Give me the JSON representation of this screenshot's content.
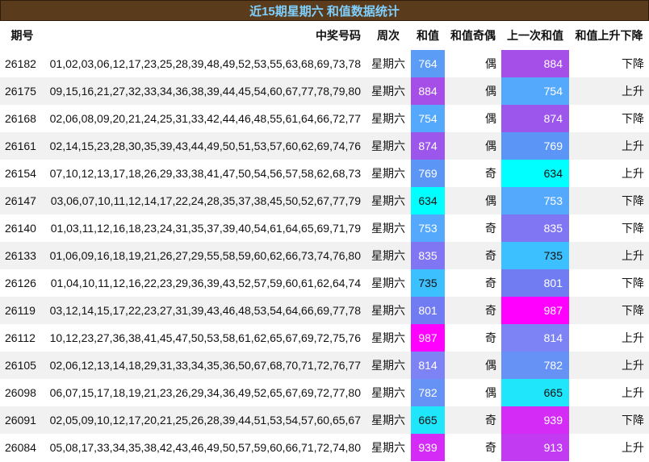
{
  "title": "近15期星期六 和值数据统计",
  "headers": {
    "period": "期号",
    "numbers": "中奖号码",
    "weekday": "周次",
    "sum": "和值",
    "parity": "和值奇偶",
    "prev_sum": "上一次和值",
    "trend": "和值上升下降"
  },
  "rows": [
    {
      "period": "26182",
      "numbers": "01,02,03,06,12,17,23,25,28,39,48,49,52,53,55,63,68,69,73,78",
      "weekday": "星期六",
      "sum": "764",
      "sum_color": "#5a9cf6",
      "parity": "偶",
      "prev_sum": "884",
      "prev_color": "#a64fe8",
      "trend": "下降"
    },
    {
      "period": "26175",
      "numbers": "09,15,16,21,27,32,33,34,36,38,39,44,45,54,60,67,77,78,79,80",
      "weekday": "星期六",
      "sum": "884",
      "sum_color": "#a64fe8",
      "parity": "偶",
      "prev_sum": "754",
      "prev_color": "#55a9fc",
      "trend": "上升"
    },
    {
      "period": "26168",
      "numbers": "02,06,08,09,20,21,24,25,31,33,42,44,46,48,55,61,64,66,72,77",
      "weekday": "星期六",
      "sum": "754",
      "sum_color": "#55a9fc",
      "parity": "偶",
      "prev_sum": "874",
      "prev_color": "#9c56ec",
      "trend": "下降"
    },
    {
      "period": "26161",
      "numbers": "02,14,15,23,28,30,35,39,43,44,49,50,51,53,57,60,62,69,74,76",
      "weekday": "星期六",
      "sum": "874",
      "sum_color": "#9c56ec",
      "parity": "偶",
      "prev_sum": "769",
      "prev_color": "#5b96f6",
      "trend": "上升"
    },
    {
      "period": "26154",
      "numbers": "07,10,12,13,17,18,26,29,33,38,41,47,50,54,56,57,58,62,68,73",
      "weekday": "星期六",
      "sum": "769",
      "sum_color": "#5b96f6",
      "parity": "奇",
      "prev_sum": "634",
      "prev_color": "#00ffff",
      "trend": "上升"
    },
    {
      "period": "26147",
      "numbers": "03,06,07,10,11,12,14,17,22,24,28,35,37,38,45,50,52,67,77,79",
      "weekday": "星期六",
      "sum": "634",
      "sum_color": "#00ffff",
      "parity": "偶",
      "prev_sum": "753",
      "prev_color": "#55a9fc",
      "trend": "下降"
    },
    {
      "period": "26140",
      "numbers": "01,03,11,12,16,18,23,24,31,35,37,39,40,54,61,64,65,69,71,79",
      "weekday": "星期六",
      "sum": "753",
      "sum_color": "#55a9fc",
      "parity": "奇",
      "prev_sum": "835",
      "prev_color": "#8075f2",
      "trend": "下降"
    },
    {
      "period": "26133",
      "numbers": "01,06,09,16,18,19,21,26,27,29,55,58,59,60,62,66,73,74,76,80",
      "weekday": "星期六",
      "sum": "835",
      "sum_color": "#8075f2",
      "parity": "奇",
      "prev_sum": "735",
      "prev_color": "#3cc0ff",
      "trend": "上升"
    },
    {
      "period": "26126",
      "numbers": "01,04,10,11,12,16,22,23,29,36,39,43,52,57,59,60,61,62,64,74",
      "weekday": "星期六",
      "sum": "735",
      "sum_color": "#3cc0ff",
      "parity": "奇",
      "prev_sum": "801",
      "prev_color": "#727cf2",
      "trend": "下降"
    },
    {
      "period": "26119",
      "numbers": "03,12,14,15,17,22,23,27,31,39,43,46,48,53,54,64,66,69,77,78",
      "weekday": "星期六",
      "sum": "801",
      "sum_color": "#727cf2",
      "parity": "奇",
      "prev_sum": "987",
      "prev_color": "#ff00ff",
      "trend": "下降"
    },
    {
      "period": "26112",
      "numbers": "10,12,23,27,36,38,41,45,47,50,53,58,61,62,65,67,69,72,75,76",
      "weekday": "星期六",
      "sum": "987",
      "sum_color": "#ff00ff",
      "parity": "奇",
      "prev_sum": "814",
      "prev_color": "#7d83f4",
      "trend": "上升"
    },
    {
      "period": "26105",
      "numbers": "02,06,12,13,14,18,29,31,33,34,35,36,50,67,68,70,71,72,76,77",
      "weekday": "星期六",
      "sum": "814",
      "sum_color": "#7d83f4",
      "parity": "偶",
      "prev_sum": "782",
      "prev_color": "#6592f4",
      "trend": "上升"
    },
    {
      "period": "26098",
      "numbers": "06,07,15,17,18,19,21,23,26,29,34,36,49,52,65,67,69,72,77,80",
      "weekday": "星期六",
      "sum": "782",
      "sum_color": "#6592f4",
      "parity": "偶",
      "prev_sum": "665",
      "prev_color": "#1fe6fb",
      "trend": "上升"
    },
    {
      "period": "26091",
      "numbers": "02,05,09,10,12,17,20,21,25,26,28,39,44,51,53,54,57,60,65,67",
      "weekday": "星期六",
      "sum": "665",
      "sum_color": "#1fe6fb",
      "parity": "奇",
      "prev_sum": "939",
      "prev_color": "#d42cf6",
      "trend": "下降"
    },
    {
      "period": "26084",
      "numbers": "05,08,17,33,34,35,38,42,43,46,49,50,57,59,60,66,71,72,74,80",
      "weekday": "星期六",
      "sum": "939",
      "sum_color": "#d42cf6",
      "parity": "奇",
      "prev_sum": "913",
      "prev_color": "#c23af2",
      "trend": "上升"
    }
  ]
}
